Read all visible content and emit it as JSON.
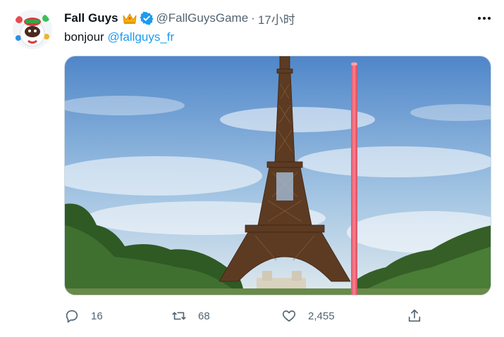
{
  "tweet": {
    "author": {
      "display_name": "Fall Guys",
      "handle": "@FallGuysGame",
      "badges": [
        "crown-icon",
        "verified-icon"
      ],
      "avatar": "fall-guys-avatar"
    },
    "separator": "·",
    "timestamp": "17小时",
    "more_icon": "more-icon",
    "text": {
      "prefix": "bonjour ",
      "mention": "@fallguys_fr"
    },
    "media": {
      "description_icon": "eiffel-tower-photo",
      "pole_color": "#f06a78"
    },
    "actions": {
      "reply": {
        "icon": "reply-icon",
        "count": "16"
      },
      "retweet": {
        "icon": "retweet-icon",
        "count": "68"
      },
      "like": {
        "icon": "heart-icon",
        "count": "2,455"
      },
      "share": {
        "icon": "share-icon"
      }
    }
  },
  "colors": {
    "link": "#1d9bf0",
    "muted": "#536471",
    "verified": "#1d9bf0",
    "text": "#0f1419"
  }
}
